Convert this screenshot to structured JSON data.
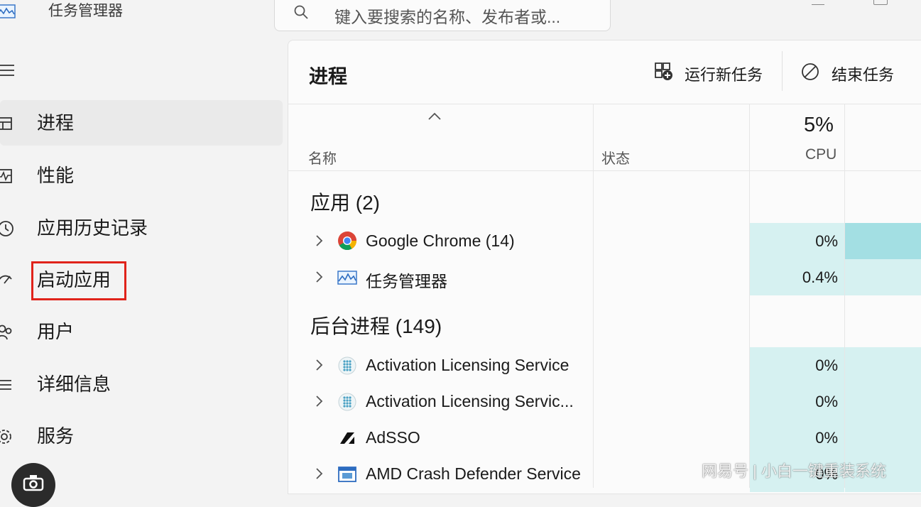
{
  "window": {
    "app_title": "任务管理器",
    "search_placeholder": "键入要搜索的名称、发布者或..."
  },
  "sidebar": {
    "items": [
      {
        "label": "进程",
        "icon": "process-grid-icon",
        "selected": true
      },
      {
        "label": "性能",
        "icon": "performance-chart-icon",
        "selected": false
      },
      {
        "label": "应用历史记录",
        "icon": "history-clock-icon",
        "selected": false
      },
      {
        "label": "启动应用",
        "icon": "startup-gauge-icon",
        "selected": false,
        "highlighted": true
      },
      {
        "label": "用户",
        "icon": "users-icon",
        "selected": false
      },
      {
        "label": "详细信息",
        "icon": "details-list-icon",
        "selected": false
      },
      {
        "label": "服务",
        "icon": "services-gear-icon",
        "selected": false
      }
    ]
  },
  "main": {
    "title": "进程",
    "toolbar": {
      "run_new_task": "运行新任务",
      "end_task": "结束任务"
    },
    "columns": {
      "name": "名称",
      "status": "状态",
      "cpu_percent": "5%",
      "cpu_label": "CPU"
    },
    "groups": {
      "apps": "应用 (2)",
      "background": "后台进程 (149)"
    },
    "rows": [
      {
        "name": "Google Chrome (14)",
        "cpu": "0%",
        "icon": "chrome-icon",
        "expandable": true
      },
      {
        "name": "任务管理器",
        "cpu": "0.4%",
        "icon": "task-manager-icon",
        "expandable": true
      },
      {
        "name": "Activation Licensing Service",
        "cpu": "0%",
        "icon": "service-dots-icon",
        "expandable": true
      },
      {
        "name": "Activation Licensing Servic...",
        "cpu": "0%",
        "icon": "service-dots-icon",
        "expandable": true
      },
      {
        "name": "AdSSO",
        "cpu": "0%",
        "icon": "adsso-logo-icon",
        "expandable": false
      },
      {
        "name": "AMD Crash Defender Service",
        "cpu": "0%",
        "icon": "window-service-icon",
        "expandable": true
      }
    ]
  },
  "watermark": "网易号 | 小白一键重装系统"
}
